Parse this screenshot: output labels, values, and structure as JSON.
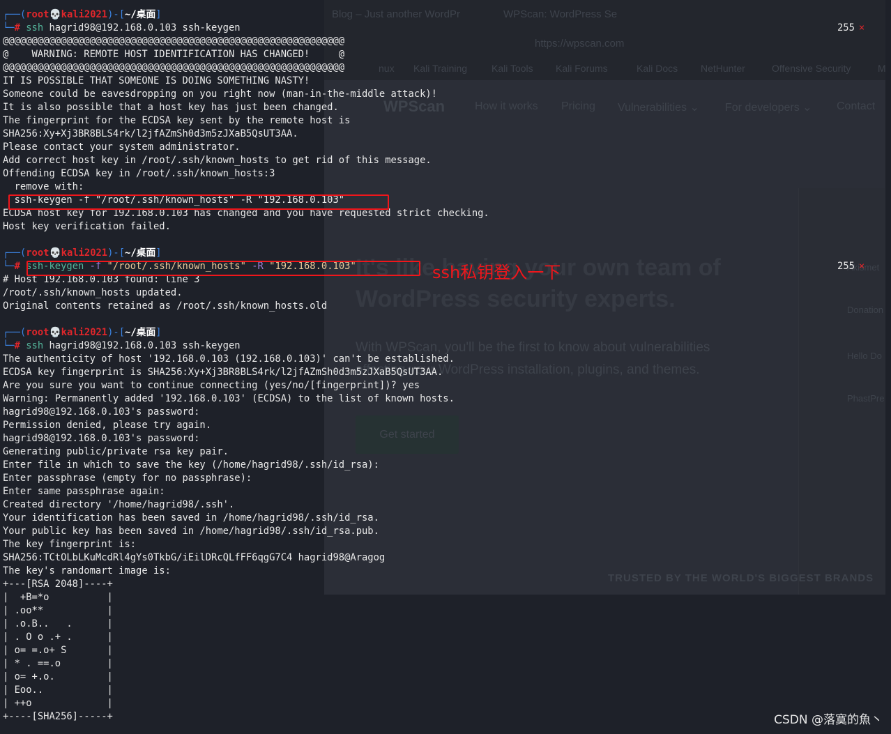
{
  "background_browser": {
    "tabs": [
      "Blog – Just another WordPr",
      "WPScan: WordPress Se"
    ],
    "url": "https://wpscan.com",
    "bookmarks": [
      "nux",
      "Kali Training",
      "Kali Tools",
      "Kali Forums",
      "Kali Docs",
      "NetHunter",
      "Offensive Security",
      "M"
    ],
    "logo": "WPScan",
    "nav": [
      "How it works",
      "Pricing",
      "Vulnerabilities ⌄",
      "For developers ⌄",
      "Contact"
    ],
    "heading": [
      "It's like having your own team of",
      "WordPress security experts."
    ],
    "subtext": [
      "With WPScan, you'll be the first to know about vulnerabilities",
      "affecting your WordPress installation, plugins, and themes."
    ],
    "cta": "Get started",
    "trusted": "TRUSTED BY THE WORLD'S BIGGEST BRANDS",
    "plugins": [
      "Akismet",
      "Donation",
      "Hello Do",
      "PhastPre"
    ]
  },
  "terminal": {
    "blocks": [
      {
        "prompt": {
          "user": "root",
          "host": "kali2021",
          "dir": "~/桌面"
        },
        "command": [
          {
            "t": "ssh",
            "k": "cmd"
          },
          {
            "t": " hagrid98@192.168.0.103 ssh-keygen",
            "k": "arg"
          }
        ],
        "exit_code": "255",
        "output": [
          "@@@@@@@@@@@@@@@@@@@@@@@@@@@@@@@@@@@@@@@@@@@@@@@@@@@@@@@@@@@",
          "@    WARNING: REMOTE HOST IDENTIFICATION HAS CHANGED!     @",
          "@@@@@@@@@@@@@@@@@@@@@@@@@@@@@@@@@@@@@@@@@@@@@@@@@@@@@@@@@@@",
          "IT IS POSSIBLE THAT SOMEONE IS DOING SOMETHING NASTY!",
          "Someone could be eavesdropping on you right now (man-in-the-middle attack)!",
          "It is also possible that a host key has just been changed.",
          "The fingerprint for the ECDSA key sent by the remote host is",
          "SHA256:Xy+Xj3BR8BLS4rk/l2jfAZmSh0d3m5zJXaB5QsUT3AA.",
          "Please contact your system administrator.",
          "Add correct host key in /root/.ssh/known_hosts to get rid of this message.",
          "Offending ECDSA key in /root/.ssh/known_hosts:3",
          "  remove with:",
          "  ssh-keygen -f \"/root/.ssh/known_hosts\" -R \"192.168.0.103\"",
          "ECDSA host key for 192.168.0.103 has changed and you have requested strict checking.",
          "Host key verification failed.",
          ""
        ]
      },
      {
        "prompt": {
          "user": "root",
          "host": "kali2021",
          "dir": "~/桌面"
        },
        "command": [
          {
            "t": "ssh-keygen",
            "k": "cmd"
          },
          {
            "t": " -f",
            "k": "opt"
          },
          {
            "t": " \"/root/.ssh/known_hosts\"",
            "k": "str"
          },
          {
            "t": " -R",
            "k": "opt"
          },
          {
            "t": " \"192.168.0.103\"",
            "k": "str"
          }
        ],
        "exit_code": "255",
        "output": [
          "# Host 192.168.0.103 found: line 3",
          "/root/.ssh/known_hosts updated.",
          "Original contents retained as /root/.ssh/known_hosts.old",
          ""
        ]
      },
      {
        "prompt": {
          "user": "root",
          "host": "kali2021",
          "dir": "~/桌面"
        },
        "command": [
          {
            "t": "ssh",
            "k": "cmd"
          },
          {
            "t": " hagrid98@192.168.0.103 ssh-keygen",
            "k": "arg"
          }
        ],
        "output": [
          "The authenticity of host '192.168.0.103 (192.168.0.103)' can't be established.",
          "ECDSA key fingerprint is SHA256:Xy+Xj3BR8BLS4rk/l2jfAZmSh0d3m5zJXaB5QsUT3AA.",
          "Are you sure you want to continue connecting (yes/no/[fingerprint])? yes",
          "Warning: Permanently added '192.168.0.103' (ECDSA) to the list of known hosts.",
          "hagrid98@192.168.0.103's password:",
          "Permission denied, please try again.",
          "hagrid98@192.168.0.103's password:",
          "Generating public/private rsa key pair.",
          "Enter file in which to save the key (/home/hagrid98/.ssh/id_rsa):",
          "Enter passphrase (empty for no passphrase):",
          "Enter same passphrase again:",
          "Created directory '/home/hagrid98/.ssh'.",
          "Your identification has been saved in /home/hagrid98/.ssh/id_rsa.",
          "Your public key has been saved in /home/hagrid98/.ssh/id_rsa.pub.",
          "The key fingerprint is:",
          "SHA256:TCtOLbLKuMcdRl4gYs0TkbG/iEilDRcQLfFF6qgG7C4 hagrid98@Aragog",
          "The key's randomart image is:",
          "+---[RSA 2048]----+",
          "|  +B=*o          |",
          "| .oo**           |",
          "| .o.B..   .      |",
          "| . O o .+ .      |",
          "| o= =.o+ S       |",
          "| * . ==.o        |",
          "| o= +.o.         |",
          "| Eoo..           |",
          "| ++o             |",
          "+----[SHA256]-----+"
        ]
      }
    ]
  },
  "annotation": {
    "text": "ssh私钥登入一下",
    "color": "#f0161b"
  },
  "watermark": "CSDN @落寞的魚丶"
}
